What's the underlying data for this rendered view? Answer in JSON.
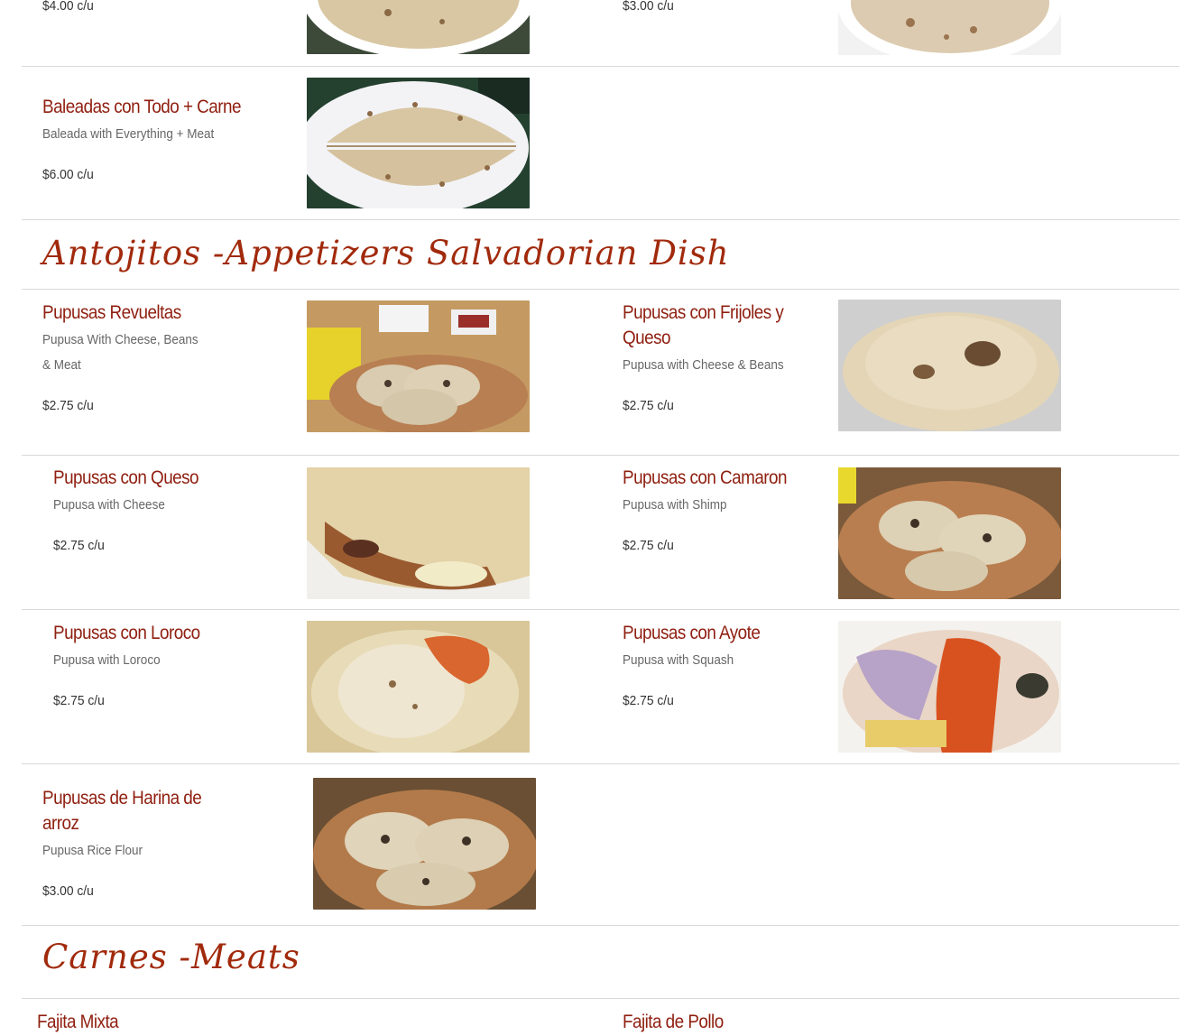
{
  "top_row": {
    "left_price": "$4.00 c/u",
    "right_price": "$3.00 c/u"
  },
  "baleadas": {
    "name": "Baleadas con Todo + Carne",
    "desc": "Baleada with Everything + Meat",
    "price": "$6.00 c/u"
  },
  "section_appetizers": {
    "title": "Antojitos -Appetizers  Salvadorian Dish"
  },
  "pupusas": [
    {
      "name": "Pupusas Revueltas",
      "desc": "Pupusa With Cheese, Beans & Meat",
      "price": "$2.75 c/u"
    },
    {
      "name": "Pupusas con Frijoles y Queso",
      "desc": "Pupusa with Cheese & Beans",
      "price": "$2.75 c/u"
    },
    {
      "name": "Pupusas con Queso",
      "desc": "Pupusa with Cheese",
      "price": "$2.75 c/u"
    },
    {
      "name": "Pupusas con Camaron",
      "desc": "Pupusa with Shimp",
      "price": "$2.75 c/u"
    },
    {
      "name": "Pupusas con Loroco",
      "desc": "Pupusa with Loroco",
      "price": "$2.75 c/u"
    },
    {
      "name": "Pupusas con Ayote",
      "desc": "Pupusa with Squash",
      "price": "$2.75 c/u"
    },
    {
      "name": "Pupusas de Harina de arroz",
      "desc": "Pupusa Rice Flour",
      "price": "$3.00 c/u"
    }
  ],
  "section_meats": {
    "title": "Carnes -Meats"
  },
  "meats": [
    {
      "name": "Fajita Mixta"
    },
    {
      "name": "Fajita de Pollo"
    }
  ],
  "colors": {
    "item_name": "#8f1f10",
    "section_title": "#a12a0c",
    "divider": "#d9d9d9"
  }
}
